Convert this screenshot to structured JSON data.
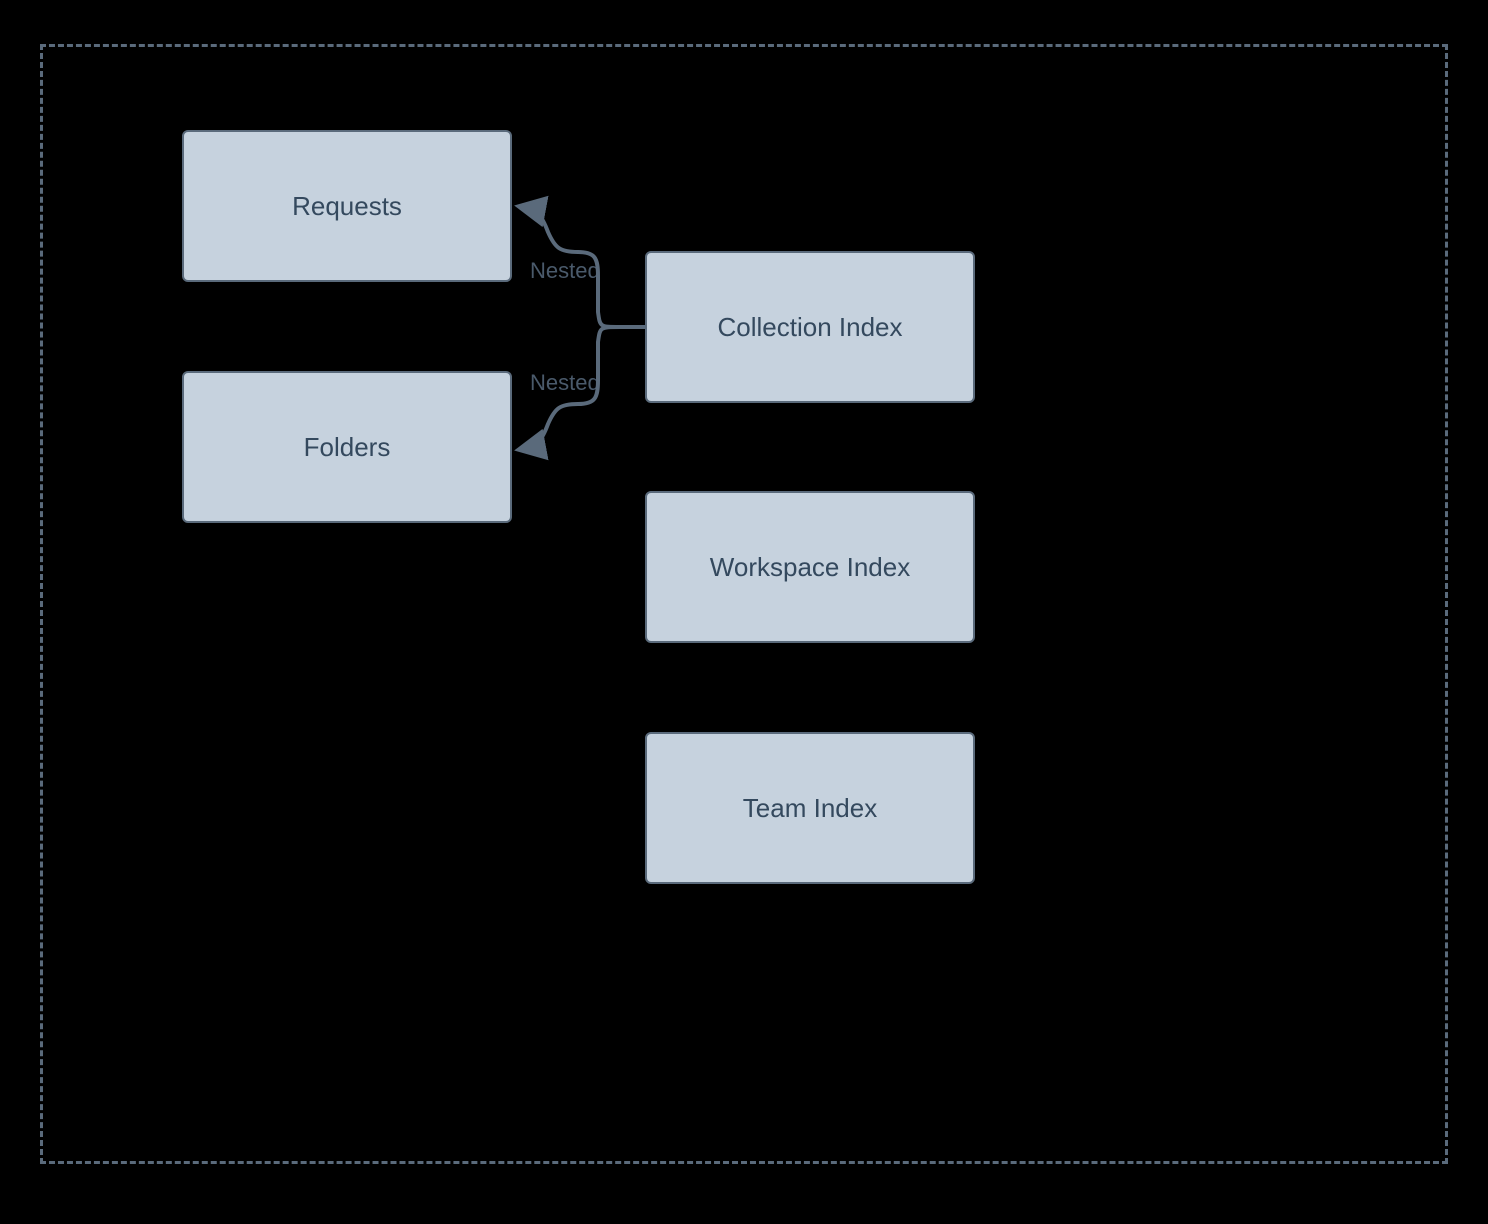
{
  "diagram": {
    "boxes": {
      "requests": "Requests",
      "folders": "Folders",
      "collection_index": "Collection Index",
      "workspace_index": "Workspace Index",
      "team_index": "Team Index"
    },
    "edge_labels": {
      "nested_upper": "Nested",
      "nested_lower": "Nested"
    },
    "colors": {
      "background": "#000000",
      "box_fill": "#c6d2de",
      "box_border": "#5a6a7b",
      "box_text": "#34495e",
      "dashed_border": "#5a6a7b",
      "connector": "#5a6a7b"
    }
  }
}
